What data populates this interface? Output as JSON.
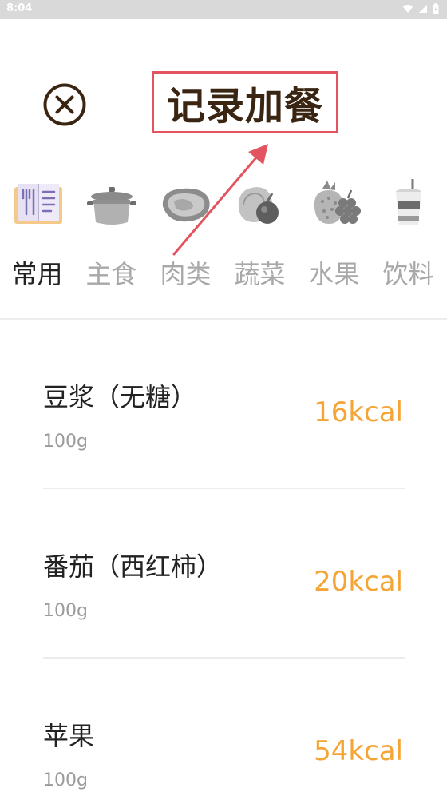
{
  "status_bar": {
    "time": "8:04",
    "icons": [
      "wifi-icon",
      "signal-icon",
      "battery-icon"
    ]
  },
  "header": {
    "close_icon": "close-circle-icon",
    "title": "记录加餐",
    "highlight_color": "#e2545f"
  },
  "categories": [
    {
      "label": "常用",
      "icon": "menu-book-icon",
      "active": true
    },
    {
      "label": "主食",
      "icon": "cooking-pot-icon",
      "active": false
    },
    {
      "label": "肉类",
      "icon": "meat-icon",
      "active": false
    },
    {
      "label": "蔬菜",
      "icon": "vegetables-icon",
      "active": false
    },
    {
      "label": "水果",
      "icon": "fruit-icon",
      "active": false
    },
    {
      "label": "饮料",
      "icon": "drink-cup-icon",
      "active": false
    }
  ],
  "foods": [
    {
      "name": "豆浆（无糖）",
      "amount": "100g",
      "kcal": "16kcal"
    },
    {
      "name": "番茄（西红柿）",
      "amount": "100g",
      "kcal": "20kcal"
    },
    {
      "name": "苹果",
      "amount": "100g",
      "kcal": "54kcal"
    }
  ],
  "colors": {
    "kcal": "#f5a535",
    "title": "#3a2412",
    "active_tab": "#222222",
    "inactive_tab": "#a8a8a8"
  }
}
